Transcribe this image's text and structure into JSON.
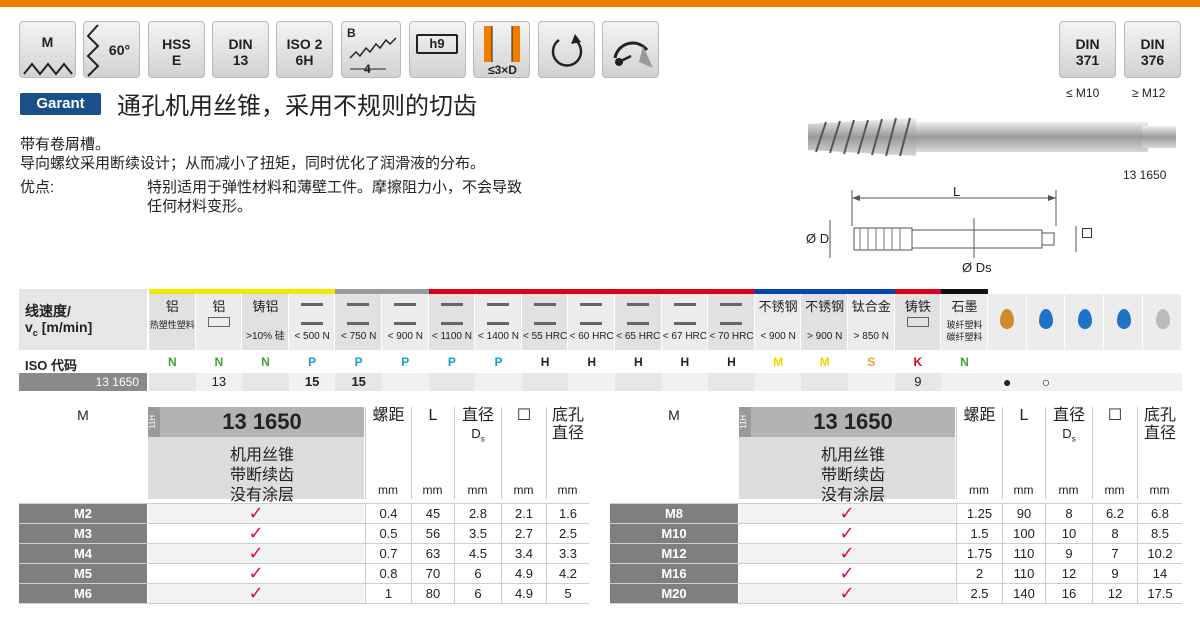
{
  "icons": {
    "m": "M",
    "angle": "60°",
    "hsse": [
      "HSS",
      "E"
    ],
    "din13": [
      "DIN",
      "13"
    ],
    "iso": [
      "ISO 2",
      "6H"
    ],
    "chamfer_b": "B",
    "chamfer_len": "4",
    "h9": "h9",
    "depth": "≤3×D"
  },
  "standards": {
    "din371": [
      "DIN",
      "371"
    ],
    "din376": [
      "DIN",
      "376"
    ],
    "le_m10": "≤ M10",
    "ge_m12": "≥ M12"
  },
  "brand": "Garant",
  "title": "通孔机用丝锥，采用不规则的切齿",
  "desc": {
    "line1": "带有卷屑槽。",
    "line2": "导向螺纹采用断续设计；从而减小了扭矩，同时优化了润滑液的分布。",
    "adv_label": "优点:",
    "adv_text1": "特别适用于弹性材料和薄壁工件。摩擦阻力小，不会导致",
    "adv_text2": "任何材料变形。"
  },
  "drawing": {
    "code": "13 1650",
    "L": "L",
    "D": "Ø D",
    "Ds": "Ø Ds"
  },
  "materials": {
    "speed_label1": "线速度/",
    "speed_label2": "v",
    "speed_sub": "c",
    "speed_label3": " [m/min]",
    "iso_label": "ISO 代码",
    "code_label": "13 1650",
    "cols": [
      {
        "l1": "铝",
        "l2": "热塑性塑料",
        "iso": "N",
        "v": "",
        "color": "#f5e800"
      },
      {
        "l1": "铝",
        "l2": "",
        "iso": "N",
        "v": "13",
        "color": "#f5e800"
      },
      {
        "l1": "铸铝",
        "l2": ">10% 硅",
        "iso": "N",
        "v": "",
        "color": "#f5e800"
      },
      {
        "l1": "< 500 N",
        "l2": "",
        "iso": "P",
        "v": "15",
        "color": "#f5e800"
      },
      {
        "l1": "< 750 N",
        "l2": "",
        "iso": "P",
        "v": "15",
        "color": "#9a9a9a"
      },
      {
        "l1": "< 900 N",
        "l2": "",
        "iso": "P",
        "v": "",
        "color": "#9a9a9a"
      },
      {
        "l1": "< 1100 N",
        "l2": "",
        "iso": "P",
        "v": "",
        "color": "#d6001c"
      },
      {
        "l1": "< 1400 N",
        "l2": "",
        "iso": "P",
        "v": "",
        "color": "#d6001c"
      },
      {
        "l1": "< 55 HRC",
        "l2": "",
        "iso": "H",
        "v": "",
        "color": "#d6001c"
      },
      {
        "l1": "< 60 HRC",
        "l2": "",
        "iso": "H",
        "v": "",
        "color": "#d6001c"
      },
      {
        "l1": "< 65 HRC",
        "l2": "",
        "iso": "H",
        "v": "",
        "color": "#d6001c"
      },
      {
        "l1": "< 67 HRC",
        "l2": "",
        "iso": "H",
        "v": "",
        "color": "#d6001c"
      },
      {
        "l1": "< 70 HRC",
        "l2": "",
        "iso": "H",
        "v": "",
        "color": "#d6001c"
      },
      {
        "l1": "不锈钢",
        "l2": "< 900 N",
        "iso": "M",
        "v": "",
        "color": "#0046ad"
      },
      {
        "l1": "不锈钢",
        "l2": "> 900 N",
        "iso": "M",
        "v": "",
        "color": "#0046ad"
      },
      {
        "l1": "钛合金",
        "l2": "> 850 N",
        "iso": "S",
        "v": "",
        "color": "#0046ad"
      },
      {
        "l1": "铸铁",
        "l2": "",
        "iso": "K",
        "v": "9",
        "color": "#d6001c"
      },
      {
        "l1": "石墨",
        "l2": "玻纤塑料 碳纤塑料",
        "iso": "N",
        "v": "",
        "color": "#111111"
      }
    ],
    "coolant": [
      "●",
      "○",
      "",
      "",
      ""
    ],
    "iso_colors": {
      "N": "#3da535",
      "P": "#1e9bd7",
      "H": "#222222",
      "M": "#f5d300",
      "S": "#f0a030",
      "K": "#e2001a"
    }
  },
  "table": {
    "col_m": "M",
    "code": "13 1650",
    "side": "11H",
    "desc": [
      "机用丝锥",
      "带断续齿",
      "没有涂层"
    ],
    "h_pitch": "螺距",
    "h_L": "L",
    "h_ds1": "直径",
    "h_ds2": "D",
    "h_ds_sub": "s",
    "h_sq": "☐",
    "h_hole1": "底孔",
    "h_hole2": "直径",
    "unit": "mm",
    "left": [
      [
        "M2",
        "0.4",
        "45",
        "2.8",
        "2.1",
        "1.6"
      ],
      [
        "M3",
        "0.5",
        "56",
        "3.5",
        "2.7",
        "2.5"
      ],
      [
        "M4",
        "0.7",
        "63",
        "4.5",
        "3.4",
        "3.3"
      ],
      [
        "M5",
        "0.8",
        "70",
        "6",
        "4.9",
        "4.2"
      ],
      [
        "M6",
        "1",
        "80",
        "6",
        "4.9",
        "5"
      ]
    ],
    "right": [
      [
        "M8",
        "1.25",
        "90",
        "8",
        "6.2",
        "6.8"
      ],
      [
        "M10",
        "1.5",
        "100",
        "10",
        "8",
        "8.5"
      ],
      [
        "M12",
        "1.75",
        "110",
        "9",
        "7",
        "10.2"
      ],
      [
        "M16",
        "2",
        "110",
        "12",
        "9",
        "14"
      ],
      [
        "M20",
        "2.5",
        "140",
        "16",
        "12",
        "17.5"
      ]
    ],
    "check": "✓"
  }
}
